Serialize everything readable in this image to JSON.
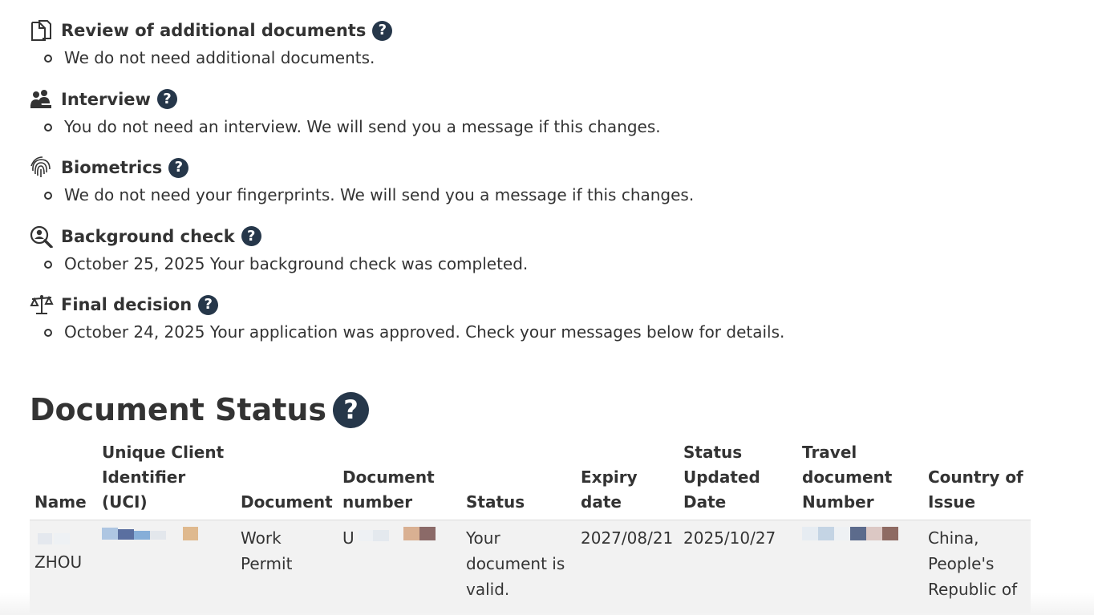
{
  "steps": [
    {
      "id": "review",
      "icon": "documents-icon",
      "title": "Review of additional documents",
      "message": "We do not need additional documents."
    },
    {
      "id": "interview",
      "icon": "people-icon",
      "title": "Interview",
      "message": "You do not need an interview. We will send you a message if this changes."
    },
    {
      "id": "biometrics",
      "icon": "fingerprint-icon",
      "title": "Biometrics",
      "message": "We do not need your fingerprints. We will send you a message if this changes."
    },
    {
      "id": "background",
      "icon": "magnifier-person-icon",
      "title": "Background check",
      "message": "October 25, 2025 Your background check was completed."
    },
    {
      "id": "decision",
      "icon": "scales-icon",
      "title": "Final decision",
      "message": "October 24, 2025 Your application was approved. Check your messages below for details."
    }
  ],
  "help_symbol": "?",
  "document_status": {
    "heading": "Document Status",
    "columns": [
      "Name",
      "Unique Client Identifier (UCI)",
      "Document",
      "Document number",
      "Status",
      "Expiry date",
      "Status Updated Date",
      "Travel document Number",
      "Country of Issue"
    ],
    "row": {
      "name": "ZHOU",
      "document": "Work Permit",
      "document_number_prefix": "U",
      "status": "Your document is valid.",
      "expiry_date": "2027/08/21",
      "status_updated_date": "2025/10/27",
      "country_of_issue": "China, People's Republic of"
    }
  },
  "colors": {
    "help_icon_bg": "#26374a",
    "text": "#333333",
    "row_bg": "#f2f2f2"
  }
}
